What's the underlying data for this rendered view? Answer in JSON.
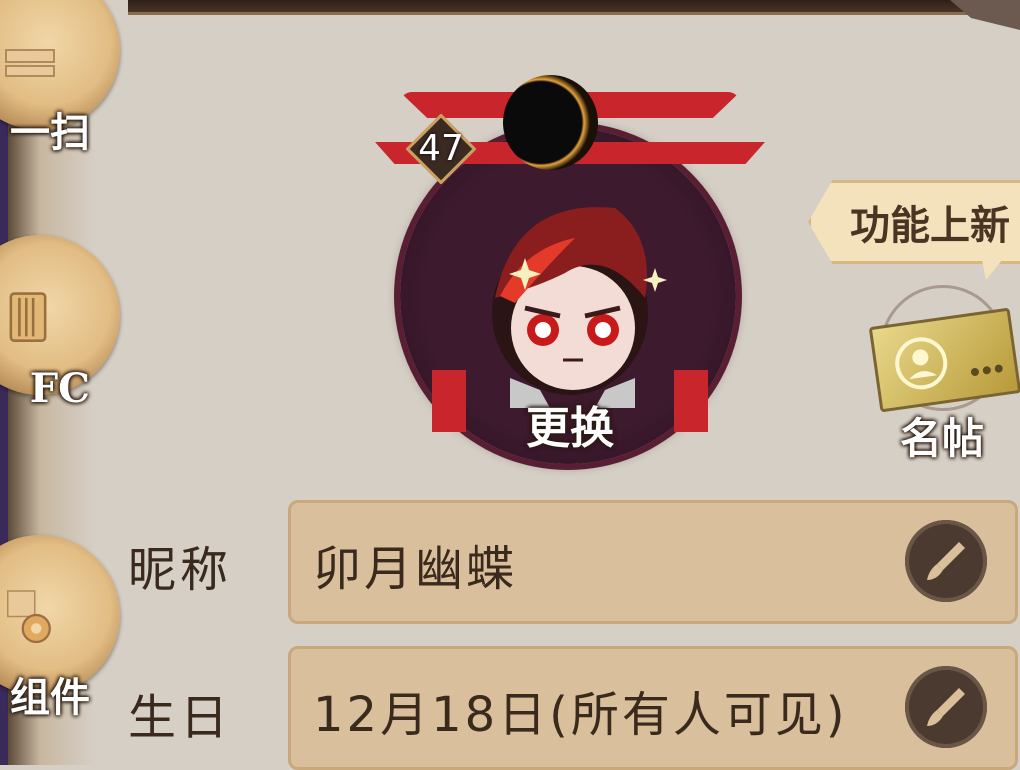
{
  "left_rail": {
    "items": [
      {
        "label": "一扫",
        "icon": "scan-icon"
      },
      {
        "label": "FC",
        "icon": "film-icon"
      },
      {
        "label": "组件",
        "icon": "gear-icon"
      }
    ]
  },
  "avatar": {
    "level": "47",
    "change_label": "更换",
    "icon": "avatar-portrait"
  },
  "notice": {
    "text": "功能上新"
  },
  "namecard": {
    "label": "名帖",
    "icon": "name-card-icon"
  },
  "profile": {
    "nickname": {
      "label": "昵称",
      "value": "卯月幽蝶"
    },
    "birthday": {
      "label": "生日",
      "value": "12月18日(所有人可见)"
    }
  },
  "colors": {
    "background": "#d6cfc6",
    "field_bg": "#d9bf9b",
    "torii_red": "#c8252d",
    "text_dark": "#3a2a1e"
  }
}
